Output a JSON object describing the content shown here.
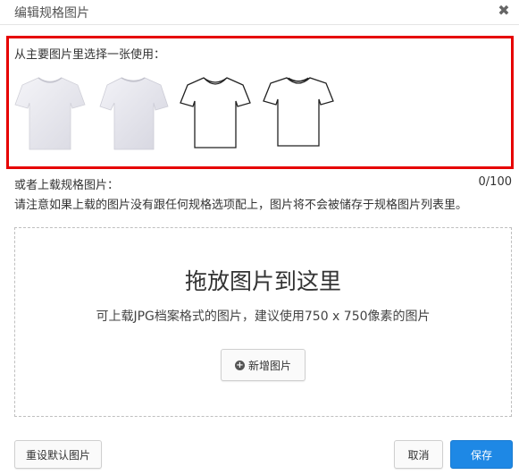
{
  "dialog": {
    "title": "编辑规格图片",
    "close_icon": "close-icon"
  },
  "main_images": {
    "label": "从主要图片里选择一张使用：",
    "thumbnails": [
      {
        "name": "white-tshirt-photo-front"
      },
      {
        "name": "white-tshirt-photo-angle"
      },
      {
        "name": "tshirt-outline-drawing"
      },
      {
        "name": "tshirt-outline-drawing-alt"
      }
    ]
  },
  "upload": {
    "label": "或者上载规格图片：",
    "counter": "0/100",
    "notice": "请注意如果上载的图片没有跟任何规格选项配上，图片将不会被储存于规格图片列表里。"
  },
  "dropzone": {
    "title": "拖放图片到这里",
    "hint": "可上载JPG档案格式的图片，建议使用750 x 750像素的图片",
    "add_button": "新增图片",
    "add_icon": "plus-circle-icon"
  },
  "footer": {
    "reset_button": "重设默认图片",
    "cancel_button": "取消",
    "save_button": "保存"
  },
  "colors": {
    "highlight_border": "#e60000",
    "primary": "#1e88e5"
  }
}
